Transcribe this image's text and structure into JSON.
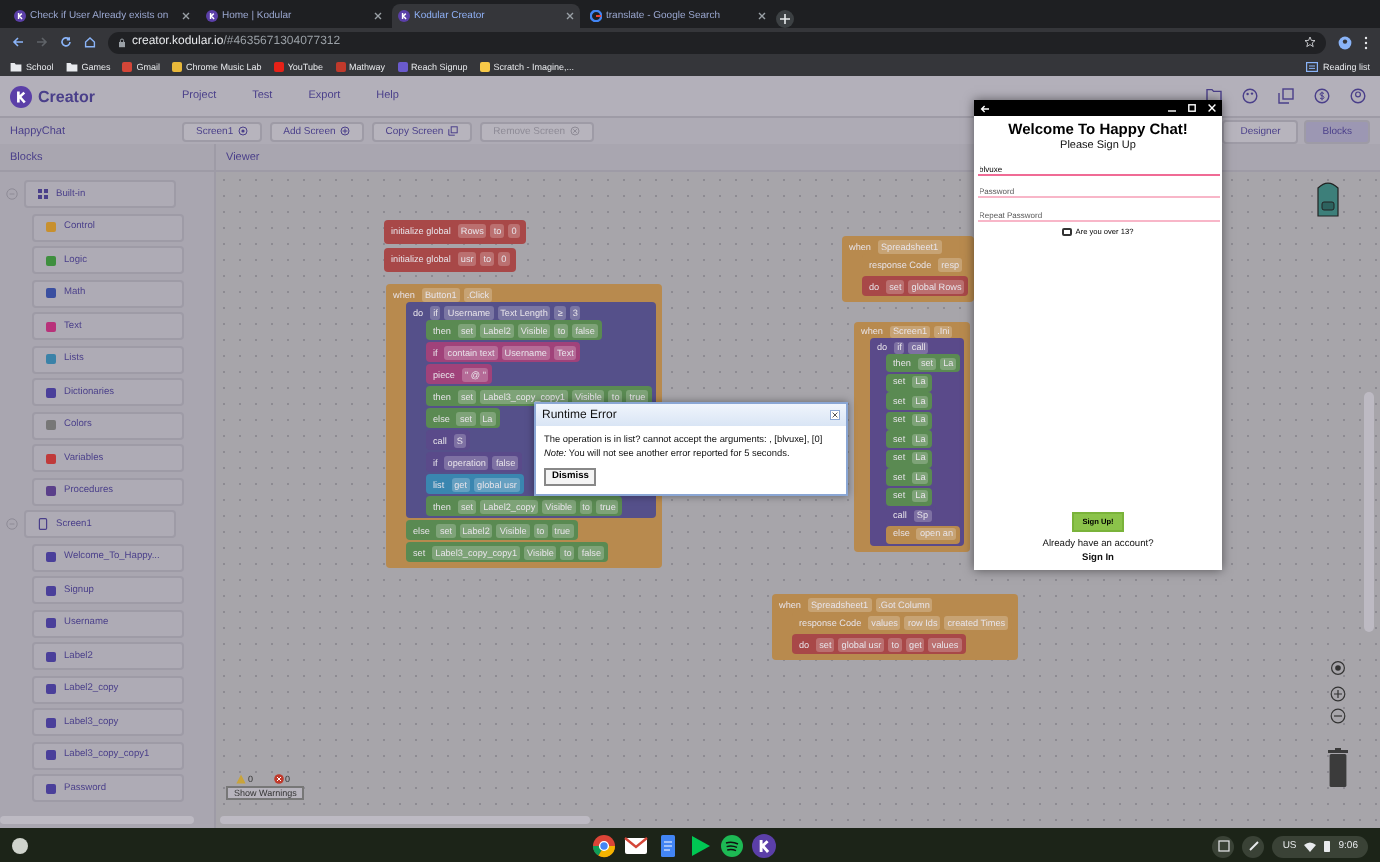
{
  "browser": {
    "tabs": [
      {
        "title": "Check if User Already exists on",
        "kind": "kodular",
        "selected": false
      },
      {
        "title": "Home | Kodular",
        "kind": "kodular",
        "selected": false
      },
      {
        "title": "Kodular Creator",
        "kind": "kodular",
        "selected": true
      },
      {
        "title": "translate - Google Search",
        "kind": "google",
        "selected": false
      }
    ],
    "address": {
      "host": "creator.kodular.io",
      "path": "/#4635671304077312"
    },
    "bookmarks": [
      {
        "label": "School",
        "kind": "folder"
      },
      {
        "label": "Games",
        "kind": "folder"
      },
      {
        "label": "Gmail",
        "kind": "site",
        "color": "#d44638"
      },
      {
        "label": "Chrome Music Lab",
        "kind": "site",
        "color": "#e8b83a"
      },
      {
        "label": "YouTube",
        "kind": "site",
        "color": "#e62117"
      },
      {
        "label": "Mathway",
        "kind": "site",
        "color": "#c0392b"
      },
      {
        "label": "Reach Signup",
        "kind": "site",
        "color": "#6a5acd"
      },
      {
        "label": "Scratch - Imagine,...",
        "kind": "site",
        "color": "#f7c948"
      }
    ],
    "reading_list": "Reading list"
  },
  "app": {
    "logo": "Creator",
    "menu": [
      "Project",
      "Test",
      "Export",
      "Help"
    ],
    "project": "HappyChat",
    "screen_buttons": [
      {
        "label": "Screen1",
        "kind": "select",
        "disabled": false
      },
      {
        "label": "Add Screen",
        "kind": "add",
        "disabled": false
      },
      {
        "label": "Copy Screen",
        "kind": "copy",
        "disabled": false
      },
      {
        "label": "Remove Screen",
        "kind": "remove",
        "disabled": true
      }
    ],
    "views": [
      {
        "label": "Designer",
        "selected": false
      },
      {
        "label": "Blocks",
        "selected": true
      }
    ]
  },
  "sidebar": {
    "title": "Blocks",
    "tree": [
      {
        "label": "Built-in",
        "expanded": true,
        "children": [
          {
            "label": "Control",
            "color": "#c8902e"
          },
          {
            "label": "Logic",
            "color": "#3f8f3f"
          },
          {
            "label": "Math",
            "color": "#3a4fa0"
          },
          {
            "label": "Text",
            "color": "#b8327a"
          },
          {
            "label": "Lists",
            "color": "#3a82a8"
          },
          {
            "label": "Dictionaries",
            "color": "#4a3f9a"
          },
          {
            "label": "Colors",
            "color": "#777777"
          },
          {
            "label": "Variables",
            "color": "#c03a3a"
          },
          {
            "label": "Procedures",
            "color": "#5a3f8a"
          }
        ]
      },
      {
        "label": "Screen1",
        "expanded": true,
        "children": [
          {
            "label": "Welcome_To_Happy...",
            "color": "#4a3f9a"
          },
          {
            "label": "Signup",
            "color": "#4a3f9a"
          },
          {
            "label": "Username",
            "color": "#4a3f9a"
          },
          {
            "label": "Label2",
            "color": "#4a3f9a"
          },
          {
            "label": "Label2_copy",
            "color": "#4a3f9a"
          },
          {
            "label": "Label3_copy",
            "color": "#4a3f9a"
          },
          {
            "label": "Label3_copy_copy1",
            "color": "#4a3f9a"
          },
          {
            "label": "Password",
            "color": "#4a3f9a"
          }
        ]
      }
    ]
  },
  "viewer": {
    "title": "Viewer",
    "blocks": [
      {
        "color": "#a84848",
        "tokens": [
          "initialize global",
          "Rows",
          "to",
          "0"
        ]
      },
      {
        "color": "#a84848",
        "tokens": [
          "initialize global",
          "usr",
          "to",
          "0"
        ]
      },
      {
        "color": "#b88a4e",
        "tokens": [
          "when",
          "Button1",
          ".Click"
        ],
        "children": [
          {
            "color": "#55508a",
            "tokens": [
              "do",
              "if",
              "Username",
              "Text Length",
              "≥",
              "3"
            ],
            "children": [
              {
                "color": "#5a8a52",
                "tokens": [
                  "then",
                  "set",
                  "Label2",
                  "Visible",
                  "to",
                  "false"
                ]
              },
              {
                "color": "#a0427a",
                "tokens": [
                  "if",
                  "contain text",
                  "Username",
                  "Text"
                ]
              },
              {
                "color": "#a0427a",
                "tokens": [
                  "piece",
                  "\" @ \""
                ]
              },
              {
                "color": "#5a8a52",
                "tokens": [
                  "then",
                  "set",
                  "Label3_copy_copy1",
                  "Visible",
                  "to",
                  "true"
                ]
              },
              {
                "color": "#5a8a52",
                "tokens": [
                  "else",
                  "set",
                  "La"
                ]
              },
              {
                "color": "#5a4a8a",
                "tokens": [
                  "call",
                  "S"
                ]
              },
              {
                "color": "#5a4a8a",
                "tokens": [
                  "if",
                  "operation",
                  "false"
                ]
              },
              {
                "color": "#3a86b0",
                "tokens": [
                  "list",
                  "get",
                  "global usr"
                ]
              },
              {
                "color": "#5a8a52",
                "tokens": [
                  "then",
                  "set",
                  "Label2_copy",
                  "Visible",
                  "to",
                  "true"
                ]
              }
            ]
          },
          {
            "color": "#5a8a52",
            "tokens": [
              "else",
              "set",
              "Label2",
              "Visible",
              "to",
              "true"
            ]
          },
          {
            "color": "#5a8a52",
            "tokens": [
              "set",
              "Label3_copy_copy1",
              "Visible",
              "to",
              "false"
            ]
          }
        ]
      },
      {
        "color": "#b88a4e",
        "tokens": [
          "when",
          "Spreadsheet1"
        ],
        "children": [
          {
            "color": "#b88a4e",
            "tokens": [
              "response Code",
              "resp"
            ]
          },
          {
            "color": "#a84848",
            "tokens": [
              "do",
              "set",
              "global Rows"
            ]
          }
        ]
      },
      {
        "color": "#b88a4e",
        "tokens": [
          "when",
          "Screen1",
          ".Ini"
        ],
        "children": [
          {
            "color": "#5a4a8a",
            "tokens": [
              "do",
              "if",
              "call"
            ],
            "children": [
              {
                "color": "#5a8a52",
                "tokens": [
                  "then",
                  "set",
                  "La"
                ]
              },
              {
                "color": "#5a8a52",
                "tokens": [
                  "set",
                  "La"
                ]
              },
              {
                "color": "#5a8a52",
                "tokens": [
                  "set",
                  "La"
                ]
              },
              {
                "color": "#5a8a52",
                "tokens": [
                  "set",
                  "La"
                ]
              },
              {
                "color": "#5a8a52",
                "tokens": [
                  "set",
                  "La"
                ]
              },
              {
                "color": "#5a8a52",
                "tokens": [
                  "set",
                  "La"
                ]
              },
              {
                "color": "#5a8a52",
                "tokens": [
                  "set",
                  "La"
                ]
              },
              {
                "color": "#5a8a52",
                "tokens": [
                  "set",
                  "La"
                ]
              },
              {
                "color": "#5a4a8a",
                "tokens": [
                  "call",
                  "Sp"
                ]
              },
              {
                "color": "#b88a4e",
                "tokens": [
                  "else",
                  "open an"
                ]
              }
            ]
          }
        ]
      },
      {
        "color": "#b88a4e",
        "tokens": [
          "when",
          "Spreadsheet1",
          ".Got Column"
        ],
        "children": [
          {
            "color": "#b88a4e",
            "tokens": [
              "response Code",
              "values",
              "row Ids",
              "created Times"
            ]
          },
          {
            "color": "#a84848",
            "tokens": [
              "do",
              "set",
              "global usr",
              "to",
              "get",
              "values"
            ]
          }
        ]
      }
    ],
    "warnings": {
      "warning_count": "0",
      "error_count": "0",
      "button": "Show Warnings"
    }
  },
  "dialog": {
    "title": "Runtime Error",
    "message": "The operation is in list? cannot accept the arguments: , [blvuxe], [0]",
    "note": "*Note:* You will not see another error reported for 5 seconds.",
    "button": "Dismiss"
  },
  "phone": {
    "title": "Welcome To Happy Chat!",
    "subtitle": "Please Sign Up",
    "fields": [
      {
        "value": "blvuxe",
        "focused": true
      },
      {
        "placeholder": "Password",
        "focused": false
      },
      {
        "placeholder": "Repeat Password",
        "focused": false
      }
    ],
    "checkbox": {
      "label": "Are you over 13?",
      "checked": false
    },
    "button": "Sign Up!",
    "prompt": "Already have an account?",
    "link": "Sign In"
  },
  "taskbar": {
    "locale": "US",
    "time": "9:06"
  }
}
